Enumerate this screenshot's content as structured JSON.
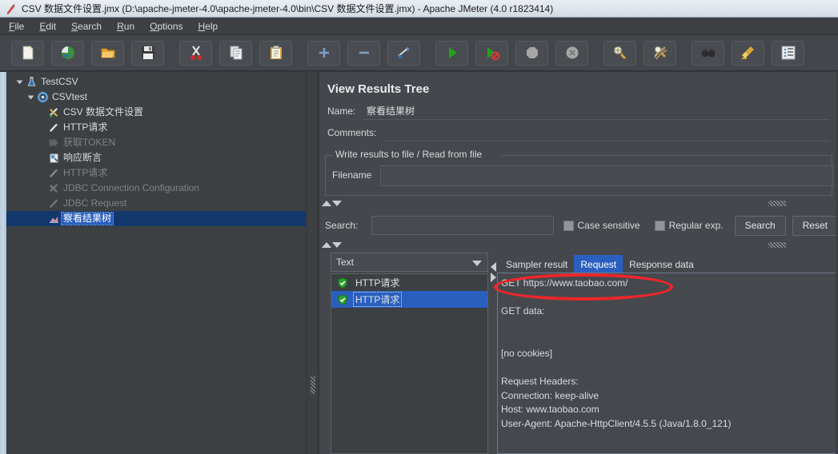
{
  "window": {
    "title": "CSV 数据文件设置.jmx (D:\\apache-jmeter-4.0\\apache-jmeter-4.0\\bin\\CSV 数据文件设置.jmx) - Apache JMeter (4.0 r1823414)",
    "icon": "jmeter-feather-icon"
  },
  "menubar": {
    "items": [
      {
        "label": "File",
        "mnemonic": "F",
        "rest": "ile"
      },
      {
        "label": "Edit",
        "mnemonic": "E",
        "rest": "dit"
      },
      {
        "label": "Search",
        "mnemonic": "S",
        "rest": "earch"
      },
      {
        "label": "Run",
        "mnemonic": "R",
        "rest": "un"
      },
      {
        "label": "Options",
        "mnemonic": "O",
        "rest": "ptions"
      },
      {
        "label": "Help",
        "mnemonic": "H",
        "rest": "elp"
      }
    ]
  },
  "toolbar": {
    "buttons": [
      {
        "name": "new-icon"
      },
      {
        "name": "templates-icon"
      },
      {
        "name": "open-icon"
      },
      {
        "name": "save-icon"
      },
      {
        "name": "cut-icon"
      },
      {
        "name": "copy-icon"
      },
      {
        "name": "paste-icon"
      },
      {
        "name": "expand-all-icon"
      },
      {
        "name": "collapse-all-icon"
      },
      {
        "name": "toggle-icon"
      },
      {
        "name": "start-icon"
      },
      {
        "name": "start-no-pauses-icon"
      },
      {
        "name": "stop-icon"
      },
      {
        "name": "shutdown-icon"
      },
      {
        "name": "clear-icon"
      },
      {
        "name": "clear-all-icon"
      },
      {
        "name": "search-icon"
      },
      {
        "name": "search-reset-icon"
      },
      {
        "name": "function-helper-icon"
      }
    ]
  },
  "tree": {
    "nodes": [
      {
        "label": "TestCSV",
        "icon": "test-plan-icon",
        "depth": 0,
        "toggle": "expanded",
        "disabled": false,
        "selected": false
      },
      {
        "label": "CSVtest",
        "icon": "thread-group-icon",
        "depth": 1,
        "toggle": "expanded",
        "disabled": false,
        "selected": false
      },
      {
        "label": "CSV 数据文件设置",
        "icon": "csv-data-set-icon",
        "depth": 2,
        "toggle": "none",
        "disabled": false,
        "selected": false
      },
      {
        "label": "HTTP请求",
        "icon": "http-sampler-icon",
        "depth": 2,
        "toggle": "none",
        "disabled": false,
        "selected": false
      },
      {
        "label": "获取TOKEN",
        "icon": "post-processor-icon",
        "depth": 2,
        "toggle": "none",
        "disabled": true,
        "selected": false
      },
      {
        "label": "响应断言",
        "icon": "assertion-icon",
        "depth": 2,
        "toggle": "none",
        "disabled": false,
        "selected": false
      },
      {
        "label": "HTTP请求",
        "icon": "http-sampler-icon",
        "depth": 2,
        "toggle": "none",
        "disabled": true,
        "selected": false
      },
      {
        "label": "JDBC Connection Configuration",
        "icon": "jdbc-config-icon",
        "depth": 2,
        "toggle": "none",
        "disabled": true,
        "selected": false
      },
      {
        "label": "JDBC Request",
        "icon": "jdbc-request-icon",
        "depth": 2,
        "toggle": "none",
        "disabled": true,
        "selected": false
      },
      {
        "label": "察看结果树",
        "icon": "view-results-tree-icon",
        "depth": 2,
        "toggle": "none",
        "disabled": false,
        "selected": true
      }
    ]
  },
  "panel": {
    "title": "View Results Tree",
    "name_label": "Name:",
    "name_value": "察看结果树",
    "comments_label": "Comments:",
    "comments_value": "",
    "file_group_legend": "Write results to file / Read from file",
    "filename_label": "Filename",
    "filename_value": ""
  },
  "search": {
    "label": "Search:",
    "value": "",
    "case_sensitive_label": "Case sensitive",
    "case_sensitive_checked": false,
    "regular_exp_label": "Regular exp.",
    "regular_exp_checked": false,
    "search_button": "Search",
    "reset_button": "Reset"
  },
  "viewer": {
    "render_selected": "Text",
    "results": [
      {
        "label": "HTTP请求",
        "status": "success",
        "selected": false
      },
      {
        "label": "HTTP请求",
        "status": "success",
        "selected": true
      }
    ],
    "tabs": [
      {
        "label": "Sampler result",
        "active": false
      },
      {
        "label": "Request",
        "active": true
      },
      {
        "label": "Response data",
        "active": false
      }
    ],
    "request_text": "GET https://www.taobao.com/\n\nGET data:\n\n\n[no cookies]\n\nRequest Headers:\nConnection: keep-alive\nHost: www.taobao.com\nUser-Agent: Apache-HttpClient/4.5.5 (Java/1.8.0_121)\n"
  },
  "annotation": {
    "type": "red-ellipse-highlight",
    "target_text": "GET https://www.taobao.com/",
    "color": "#f0252a"
  },
  "colors": {
    "window_bg": "#3c4043",
    "panel_bg": "#44484c",
    "toolbar_bg": "#43474b",
    "selection_blue": "#2a5fbf",
    "text": "#d9dce0",
    "dim_text": "#7e8388",
    "titlebar": "#dde4eb"
  }
}
